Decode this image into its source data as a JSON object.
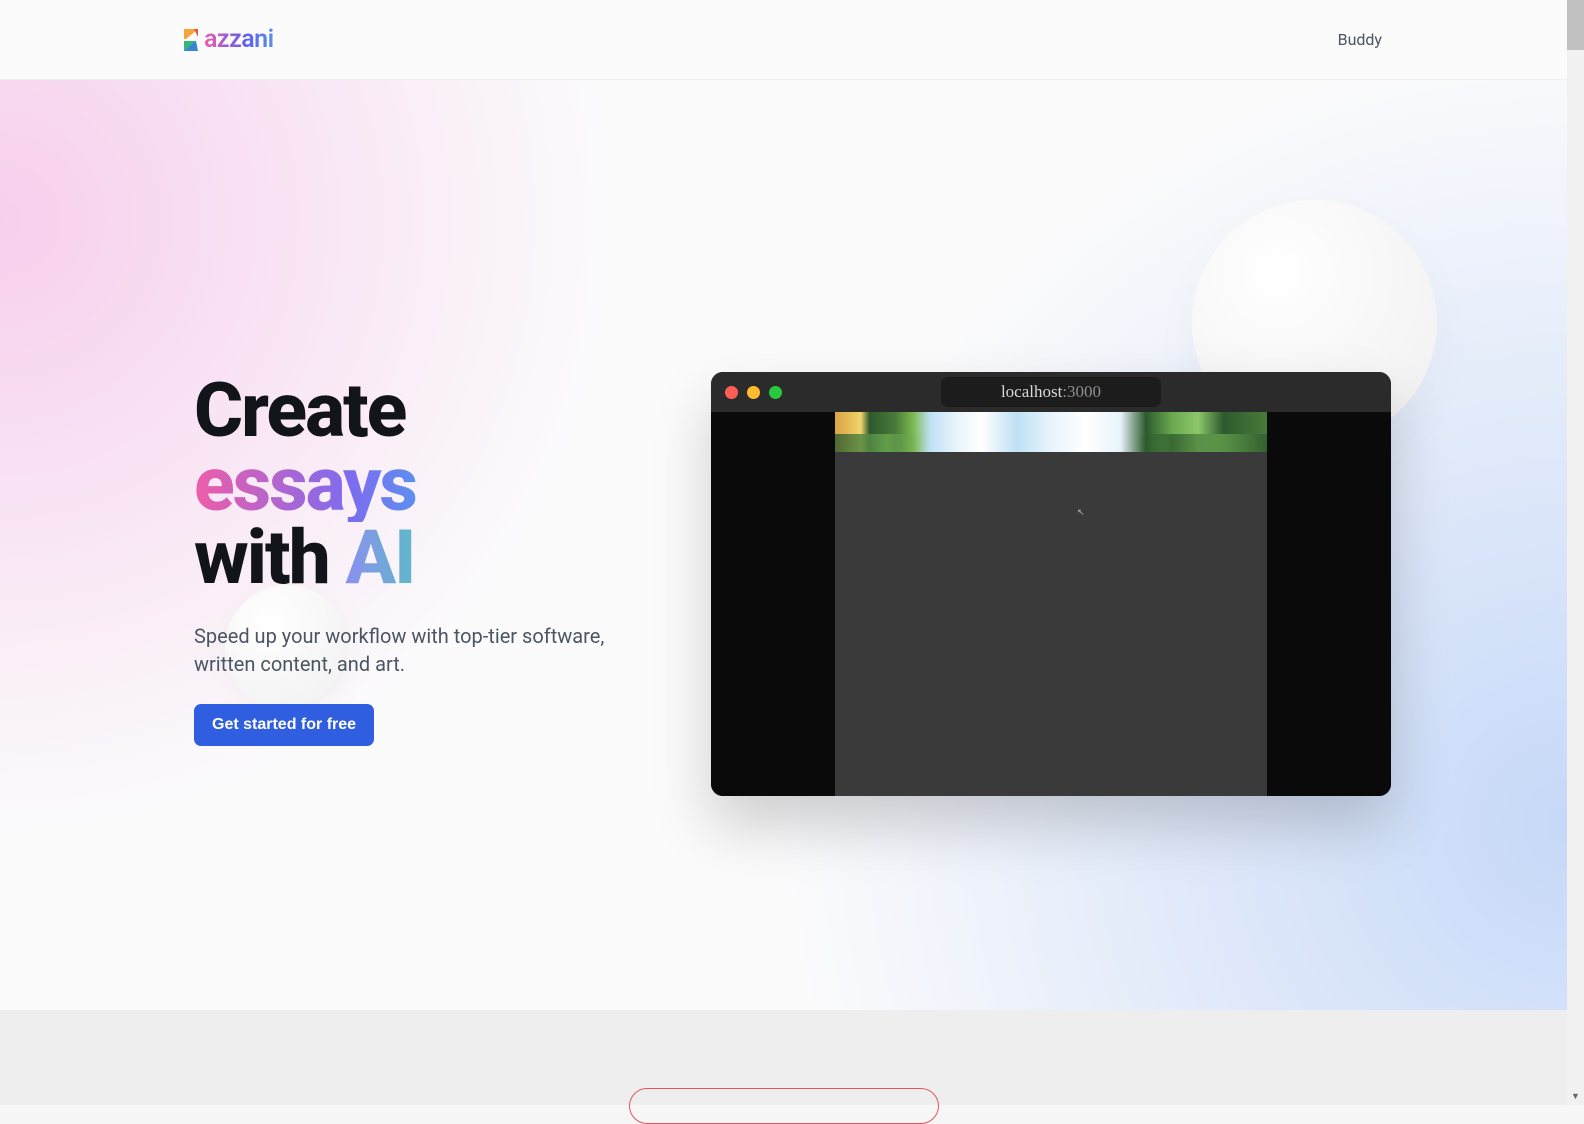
{
  "brand": {
    "name": "azzani"
  },
  "nav": {
    "link1": "Buddy"
  },
  "hero": {
    "title_line1": "Create",
    "title_line2": "essays",
    "title_line3a": "with ",
    "title_line3b": "AI",
    "subtitle": "Speed up your workflow with top-tier software, written content, and art.",
    "cta_label": "Get started for free"
  },
  "browser": {
    "url_host": "localhost",
    "url_port": ":3000"
  }
}
